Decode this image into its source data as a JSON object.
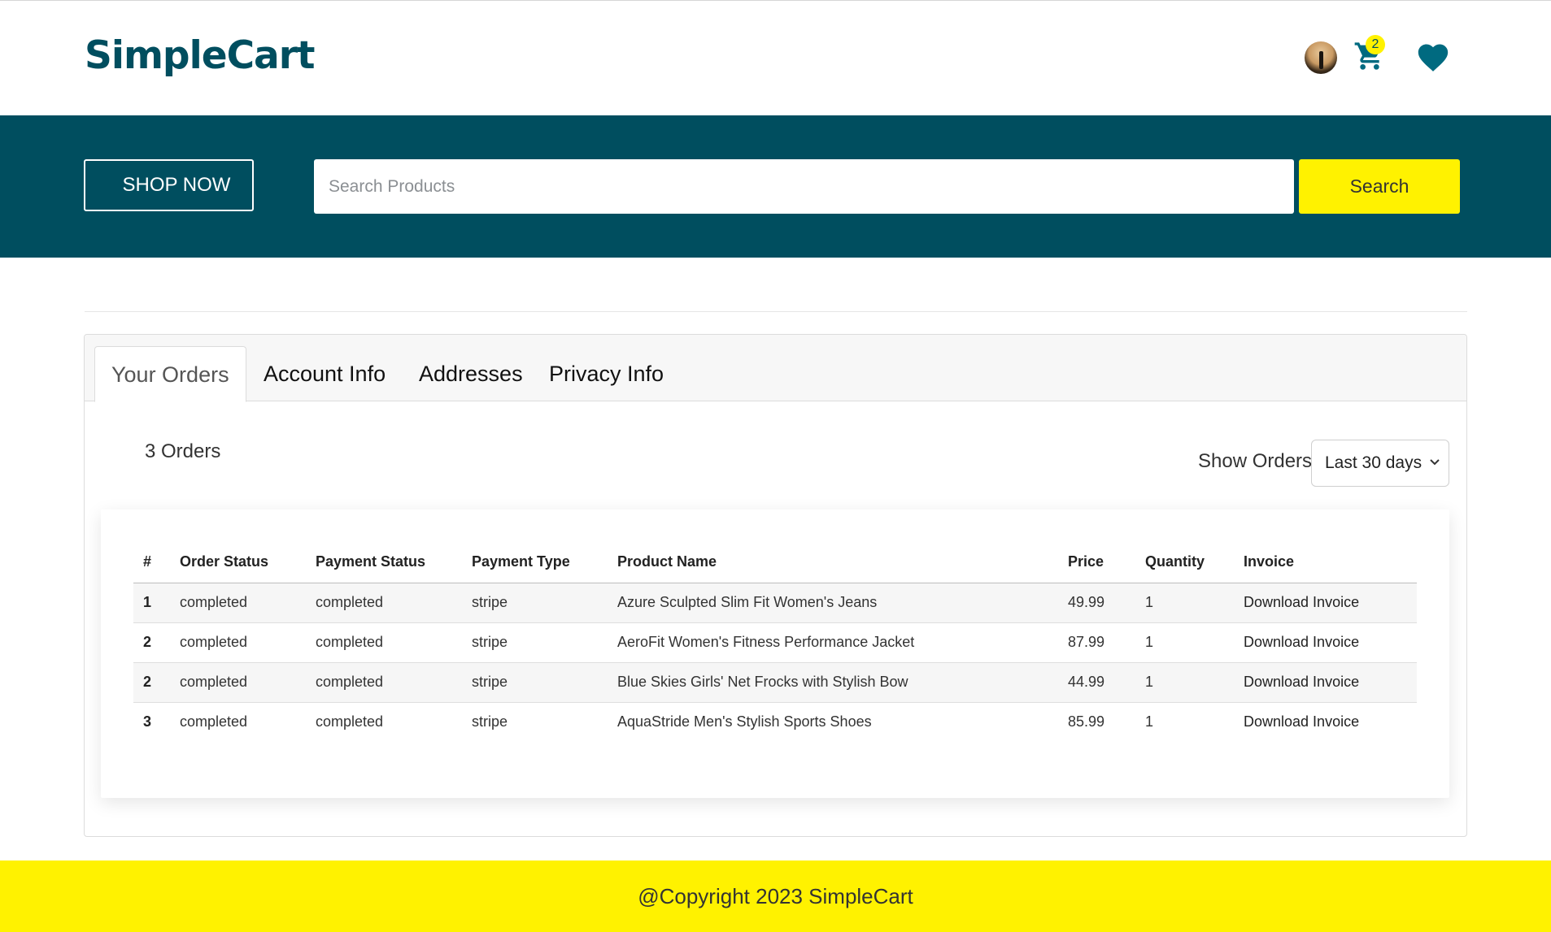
{
  "header": {
    "logo": "SimpleCart",
    "cart_count": "2"
  },
  "banner": {
    "shop_now_label": "SHOP NOW",
    "search_placeholder": "Search Products",
    "search_button_label": "Search"
  },
  "tabs": [
    {
      "label": "Your Orders",
      "active": true
    },
    {
      "label": "Account Info",
      "active": false
    },
    {
      "label": "Addresses",
      "active": false
    },
    {
      "label": "Privacy Info",
      "active": false
    }
  ],
  "orders": {
    "count_label": "3 Orders",
    "filter_label": "Show Orders",
    "filter_selected": "Last 30 days"
  },
  "table": {
    "columns": [
      "#",
      "Order Status",
      "Payment Status",
      "Payment Type",
      "Product Name",
      "Price",
      "Quantity",
      "Invoice"
    ],
    "rows": [
      {
        "num": "1",
        "order_status": "completed",
        "payment_status": "completed",
        "payment_type": "stripe",
        "product_name": "Azure Sculpted Slim Fit Women's Jeans",
        "price": "49.99",
        "quantity": "1",
        "invoice": "Download Invoice"
      },
      {
        "num": "2",
        "order_status": "completed",
        "payment_status": "completed",
        "payment_type": "stripe",
        "product_name": "AeroFit Women's Fitness Performance Jacket",
        "price": "87.99",
        "quantity": "1",
        "invoice": "Download Invoice"
      },
      {
        "num": "2",
        "order_status": "completed",
        "payment_status": "completed",
        "payment_type": "stripe",
        "product_name": "Blue Skies Girls' Net Frocks with Stylish Bow",
        "price": "44.99",
        "quantity": "1",
        "invoice": "Download Invoice"
      },
      {
        "num": "3",
        "order_status": "completed",
        "payment_status": "completed",
        "payment_type": "stripe",
        "product_name": "AquaStride Men's Stylish Sports Shoes",
        "price": "85.99",
        "quantity": "1",
        "invoice": "Download Invoice"
      }
    ]
  },
  "footer": {
    "copyright": "@Copyright 2023 SimpleCart"
  },
  "colors": {
    "brand": "#004e5f",
    "accent": "#fff200"
  },
  "icons": {
    "avatar": "avatar",
    "cart": "cart-icon",
    "wishlist": "heart-icon",
    "select_chevron": "chevron-down-icon"
  }
}
